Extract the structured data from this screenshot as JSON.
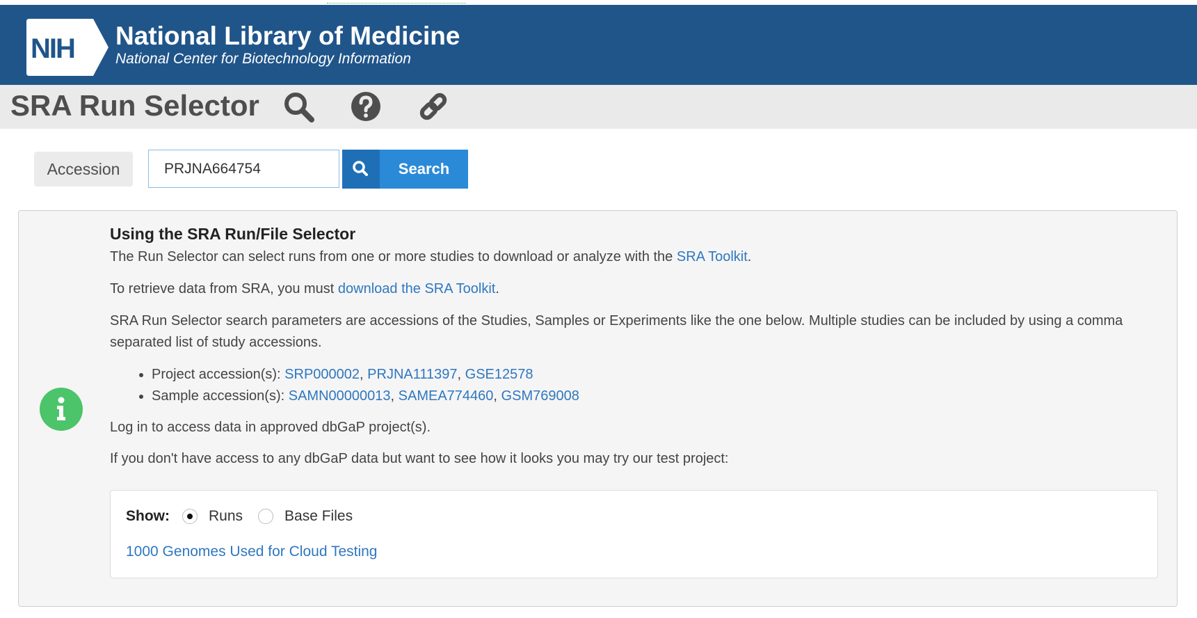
{
  "header": {
    "logo_text": "NIH",
    "org_title": "National Library of Medicine",
    "org_subtitle": "National Center for Biotechnology Information"
  },
  "toolbar": {
    "app_title": "SRA Run Selector",
    "icons": [
      "search-icon",
      "help-icon",
      "link-icon"
    ]
  },
  "search": {
    "label": "Accession",
    "value": "PRJNA664754",
    "button_label": "Search"
  },
  "info": {
    "heading": "Using the SRA Run/File Selector",
    "p1_text": "The Run Selector can select runs from one or more studies to download or analyze with the ",
    "p1_link": "SRA Toolkit",
    "p1_end": ".",
    "p2_text": "To retrieve data from SRA, you must ",
    "p2_link": "download the SRA Toolkit",
    "p2_end": ".",
    "p3_text": "SRA Run Selector search parameters are accessions of the Studies, Samples or Experiments like the one below. Multiple studies can be included by using a comma separated list of study accessions.",
    "project_label": "Project accession(s): ",
    "project_links": [
      "SRP000002",
      "PRJNA111397",
      "GSE12578"
    ],
    "sample_label": "Sample accession(s): ",
    "sample_links": [
      "SAMN00000013",
      "SAMEA774460",
      "GSM769008"
    ],
    "separator": ", ",
    "p4_text": "Log in to access data in approved dbGaP project(s).",
    "p5_text": "If you don't have access to any dbGaP data but want to see how it looks you may try our test project:"
  },
  "test_project": {
    "show_label": "Show:",
    "options": [
      "Runs",
      "Base Files"
    ],
    "selected": "Runs",
    "link": "1000 Genomes Used for Cloud Testing"
  },
  "colors": {
    "header_bg": "#20558a",
    "toolbar_bg": "#eaeaea",
    "link": "#2f77c0",
    "search_button": "#2b8ad8",
    "info_icon": "#4cc46a"
  }
}
